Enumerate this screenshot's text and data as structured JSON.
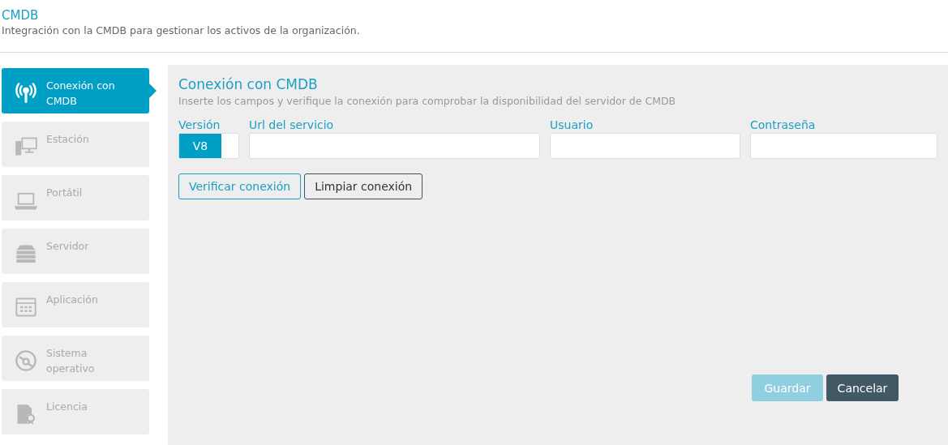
{
  "header": {
    "title": "CMDB",
    "subtitle": "Integración con la CMDB para gestionar los activos de la organización."
  },
  "sidebar": {
    "items": [
      {
        "label": "Conexión con CMDB",
        "kind": "antenna",
        "selected": true
      },
      {
        "label": "Estación",
        "kind": "desktop",
        "selected": false
      },
      {
        "label": "Portátil",
        "kind": "laptop",
        "selected": false
      },
      {
        "label": "Servidor",
        "kind": "server",
        "selected": false
      },
      {
        "label": "Aplicación",
        "kind": "app",
        "selected": false
      },
      {
        "label": "Sistema operativo",
        "kind": "disc",
        "selected": false
      },
      {
        "label": "Licencia",
        "kind": "license",
        "selected": false
      }
    ]
  },
  "panel": {
    "title": "Conexión con CMDB",
    "description": "Inserte los campos y verifique la conexión para comprobar la disponibilidad del servidor de CMDB",
    "version": {
      "label": "Versión",
      "value": "V8",
      "on": true
    },
    "fields": [
      {
        "label": "Url del servicio"
      },
      {
        "label": "Usuario"
      },
      {
        "label": "Contraseña"
      }
    ],
    "actions": [
      {
        "label": "Verificar conexión",
        "kind": "primary"
      },
      {
        "label": "Limpiar conexión",
        "kind": "secondary"
      }
    ],
    "footer": [
      {
        "label": "Guardar",
        "disabled": true
      },
      {
        "label": "Cancelar",
        "disabled": false
      }
    ]
  }
}
